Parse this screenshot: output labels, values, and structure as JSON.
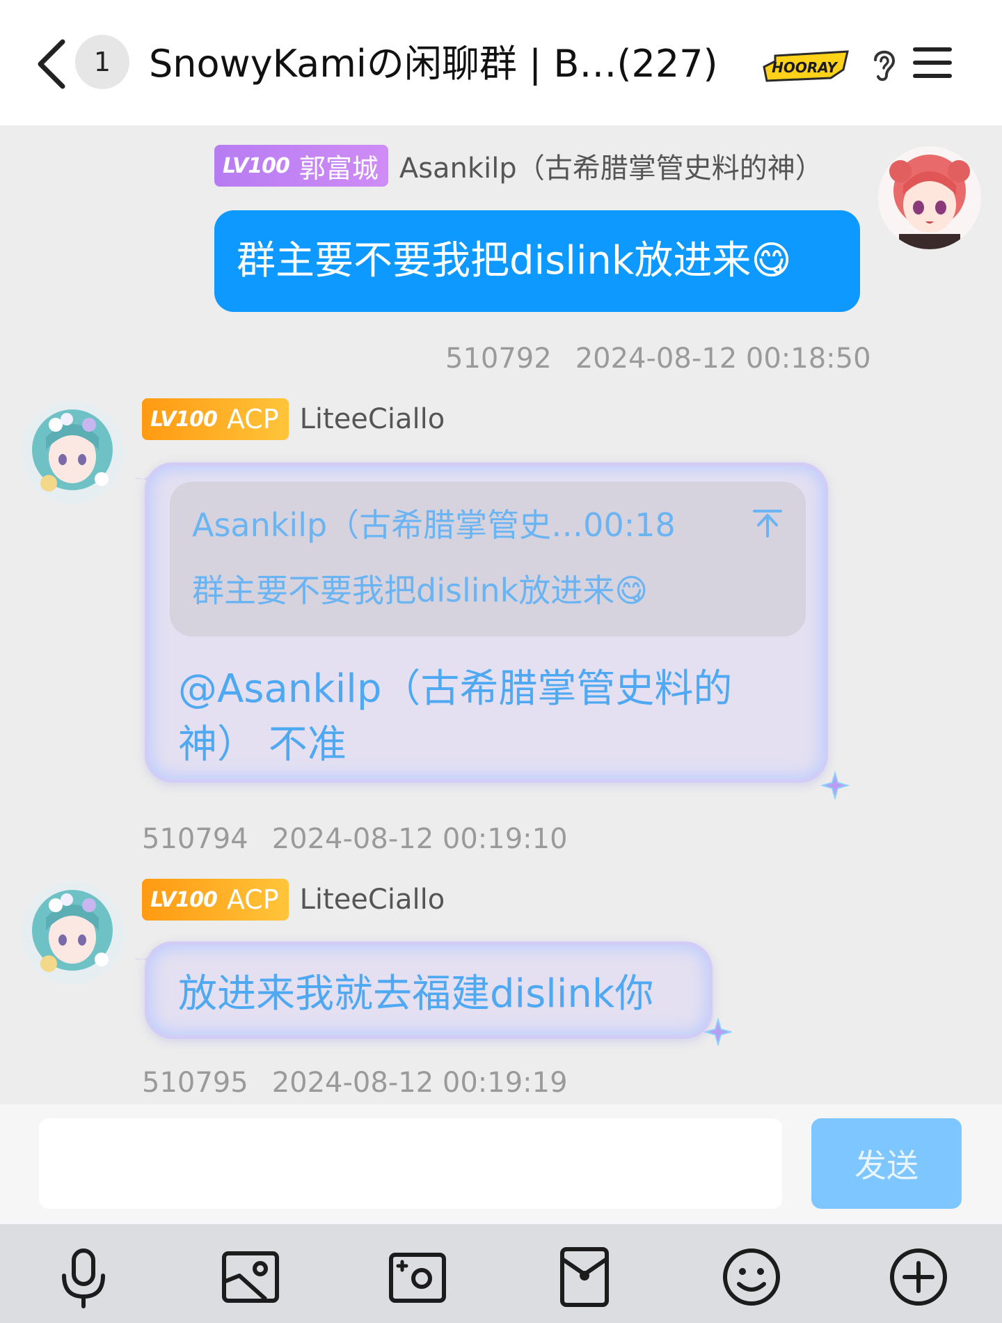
{
  "header": {
    "unread_count": "1",
    "title": "SnowyKamiの闲聊群 | B…(227)",
    "hooray_badge": "HOORAY",
    "icons": {
      "back": "chevron-left-icon",
      "ear": "ear-icon",
      "menu": "hamburger-menu-icon"
    }
  },
  "messages": [
    {
      "level": "LV100",
      "title_badge": "郭富城",
      "sender": "Asankilp（古希腊掌管史料的神）",
      "text": "群主要不要我把dislink放进来😋",
      "id": "510792",
      "time": "2024-08-12 00:18:50"
    },
    {
      "level": "LV100",
      "title_badge": "ACP",
      "sender": "LiteeCiallo",
      "quote": {
        "header": "Asankilp（古希腊掌管史…00:18",
        "text": "群主要不要我把dislink放进来😋"
      },
      "text": "@Asankilp（古希腊掌管史料的神） 不准",
      "id": "510794",
      "time": "2024-08-12 00:19:10"
    },
    {
      "level": "LV100",
      "title_badge": "ACP",
      "sender": "LiteeCiallo",
      "text": "放进来我就去福建dislink你",
      "id": "510795",
      "time": "2024-08-12 00:19:19"
    }
  ],
  "input": {
    "value": "",
    "placeholder": "",
    "send_label": "发送"
  },
  "toolbar": [
    "microphone-icon",
    "image-icon",
    "camera-icon",
    "red-packet-icon",
    "emoji-icon",
    "plus-icon"
  ],
  "colors": {
    "accent": "#0d99ff",
    "send_disabled": "#7ec6ff",
    "lv_purple": "#b77cf2",
    "lv_orange": "#ff9a12",
    "bubble_text": "#4ea8f2"
  }
}
